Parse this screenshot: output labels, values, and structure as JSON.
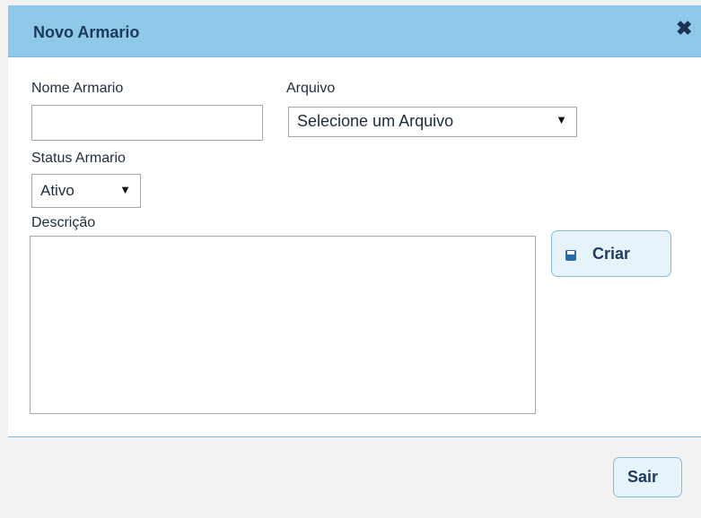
{
  "dialog": {
    "title": "Novo Armario",
    "close_icon": "close-icon"
  },
  "form": {
    "nome_label": "Nome Armario",
    "nome_value": "",
    "arquivo_label": "Arquivo",
    "arquivo_selected": "Selecione um Arquivo",
    "status_label": "Status Armario",
    "status_selected": "Ativo",
    "descricao_label": "Descrição",
    "descricao_value": ""
  },
  "buttons": {
    "criar": "Criar",
    "criar_icon": "save-icon",
    "sair": "Sair"
  },
  "colors": {
    "titlebar": "#8ec9ea",
    "button_bg": "#e6f3fb",
    "button_border": "#7fbde3",
    "divider": "#7ab9dd"
  }
}
